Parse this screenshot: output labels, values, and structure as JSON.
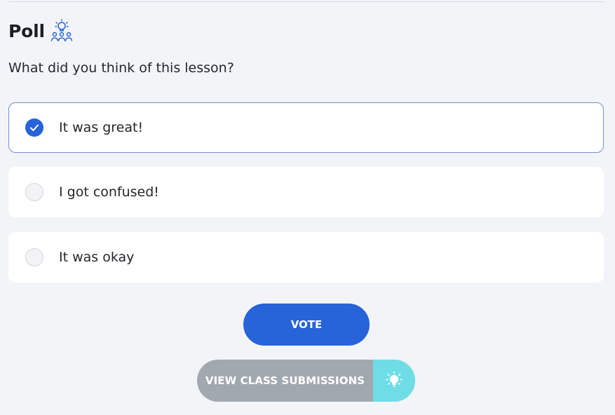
{
  "poll": {
    "title": "Poll",
    "icon": "lightbulb-people-icon",
    "question": "What did you think of this lesson?",
    "options": [
      {
        "label": "It was great!",
        "selected": true
      },
      {
        "label": "I got confused!",
        "selected": false
      },
      {
        "label": "It was okay",
        "selected": false
      }
    ]
  },
  "actions": {
    "vote_label": "VOTE",
    "view_submissions_label": "VIEW CLASS SUBMISSIONS",
    "view_submissions_icon": "lightbulb-icon"
  },
  "colors": {
    "accent": "#2763d9",
    "selected_border": "#6f8ed6",
    "submissions_button": "#a2a8b0",
    "submissions_icon_bg": "#6fdde6",
    "background": "#f2f4f8"
  }
}
